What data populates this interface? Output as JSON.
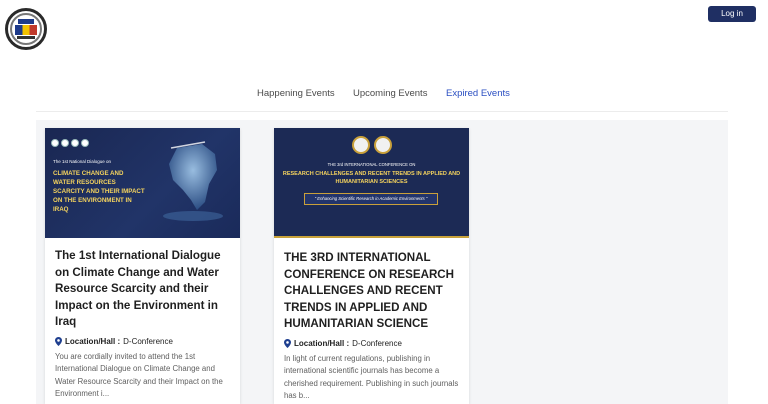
{
  "header": {
    "login_label": "Log in"
  },
  "tabs": [
    {
      "label": "Happening Events",
      "active": false
    },
    {
      "label": "Upcoming Events",
      "active": false
    },
    {
      "label": "Expired Events",
      "active": true
    }
  ],
  "events": [
    {
      "banner_subtitle": "The 1st National Dialogue on",
      "banner_title": "Climate Change and Water Resources Scarcity and Their Impact on the Environment in Iraq",
      "title": "The 1st International Dialogue on Climate Change and Water Resource Scarcity and their Impact on the Environment in Iraq",
      "location_label": "Location/Hall :",
      "location_value": "D-Conference",
      "description": "You are cordially invited to attend the 1st International Dialogue on Climate Change and Water Resource Scarcity and their Impact on the Environment i..."
    },
    {
      "banner_subtitle": "THE 3rd INTERNATIONAL CONFERENCE ON",
      "banner_title": "RESEARCH CHALLENGES AND RECENT TRENDS IN APPLIED AND HUMANITARIAN SCIENCES",
      "banner_tagline": "\" Enhancing Scientific Research in Academic Environments \"",
      "title": "THE 3RD INTERNATIONAL CONFERENCE ON RESEARCH CHALLENGES AND RECENT TRENDS IN APPLIED AND HUMANITARIAN SCIENCE",
      "location_label": "Location/Hall :",
      "location_value": "D-Conference",
      "description": "In light of current regulations, publishing in international scientific journals has become a cherished requirement. Publishing in such journals has b..."
    }
  ],
  "colors": {
    "accent": "#2b4fc2",
    "button": "#1f2f63",
    "banner": "#1c2a55",
    "banner_text": "#f4d35e"
  }
}
